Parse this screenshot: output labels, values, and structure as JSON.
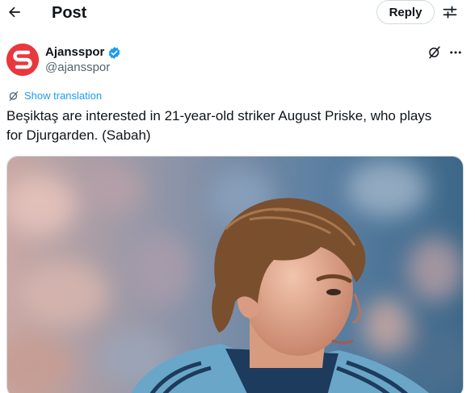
{
  "header": {
    "title": "Post",
    "back_icon": "arrow-left-icon",
    "reply_label": "Reply",
    "settings_icon": "sliders-icon"
  },
  "author": {
    "name": "Ajansspor",
    "handle": "@ajansspor",
    "verified": true,
    "avatar_color": "#e8383d",
    "avatar_logo_letter": "S"
  },
  "tweet": {
    "translate_label": "Show translation",
    "text": "Beşiktaş are interested in 21-year-old striker August Priske, who plays\nfor Djurgarden. (Sabah)"
  },
  "media": {
    "description_icon": "photo-player-image",
    "jersey_color": "#6aa6c8"
  },
  "colors": {
    "link": "#1d9bf0",
    "verified": "#1d9bf0",
    "secondary_text": "#536471",
    "border": "#cfd9de"
  }
}
